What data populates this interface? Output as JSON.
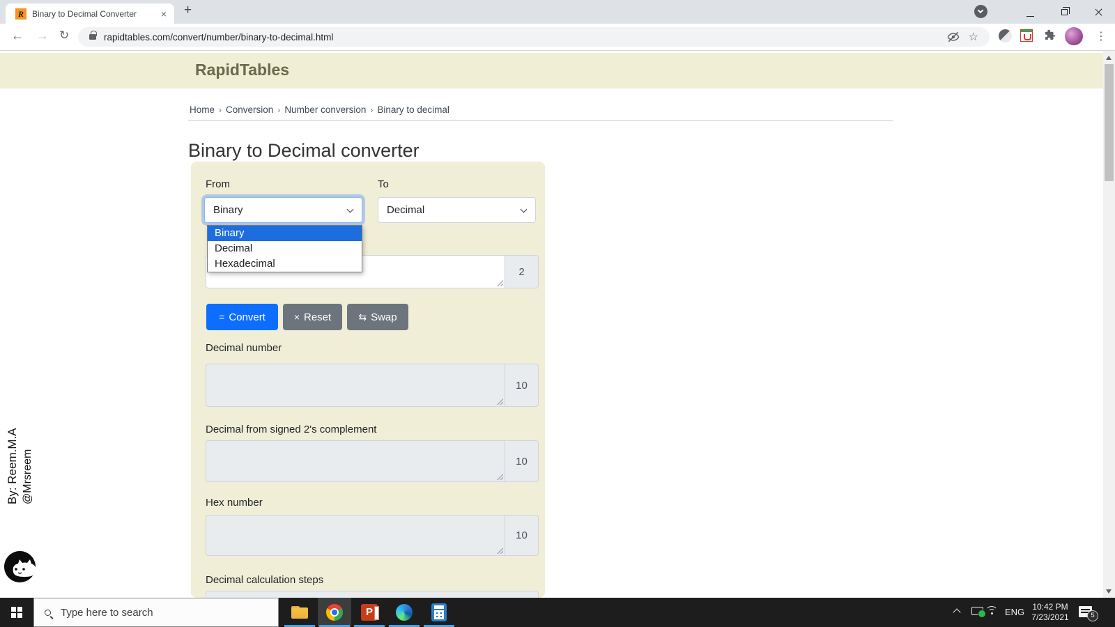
{
  "browser": {
    "tab_title": "Binary to Decimal Converter",
    "url": "rapidtables.com/convert/number/binary-to-decimal.html"
  },
  "icons": {
    "new_tab": "+",
    "tab_close": "×",
    "back": "←",
    "forward": "→",
    "reload": "↻",
    "star": "☆",
    "kebab": "⋮",
    "favicon_letter": "R"
  },
  "site": {
    "logo": "RapidTables",
    "breadcrumb": [
      "Home",
      "Conversion",
      "Number conversion",
      "Binary to decimal"
    ],
    "breadcrumb_sep": "›",
    "page_title": "Binary to Decimal converter"
  },
  "converter": {
    "from_label": "From",
    "from_value": "Binary",
    "to_label": "To",
    "to_value": "Decimal",
    "options": [
      "Binary",
      "Decimal",
      "Hexadecimal"
    ],
    "binary_suffix": "2",
    "buttons": {
      "convert_icon": "=",
      "convert_label": "Convert",
      "reset_icon": "×",
      "reset_label": "Reset",
      "swap_icon": "⇆",
      "swap_label": "Swap"
    },
    "fields": [
      {
        "label": "Decimal number",
        "suffix": "10",
        "value": ""
      },
      {
        "label": "Decimal from signed 2's complement",
        "suffix": "10",
        "value": ""
      },
      {
        "label": "Hex number",
        "suffix": "10",
        "value": ""
      },
      {
        "label": "Decimal calculation steps",
        "value": ""
      }
    ]
  },
  "watermark": {
    "line1": "By: Reem.M.A",
    "line2": "@Mrsreem"
  },
  "taskbar": {
    "search_placeholder": "Type here to search",
    "lang": "ENG",
    "time": "10:42 PM",
    "date": "7/23/2021",
    "badge": "5"
  },
  "colors": {
    "accent_blue": "#0d6efd",
    "beige_band": "#f0eed5",
    "panel_beige": "#f0eed7",
    "field_gray": "#e9ecef",
    "dropdown_highlight": "#1e6dde",
    "taskbar_underline": "#4da0dd",
    "favicon_orange": "#f7941d"
  }
}
